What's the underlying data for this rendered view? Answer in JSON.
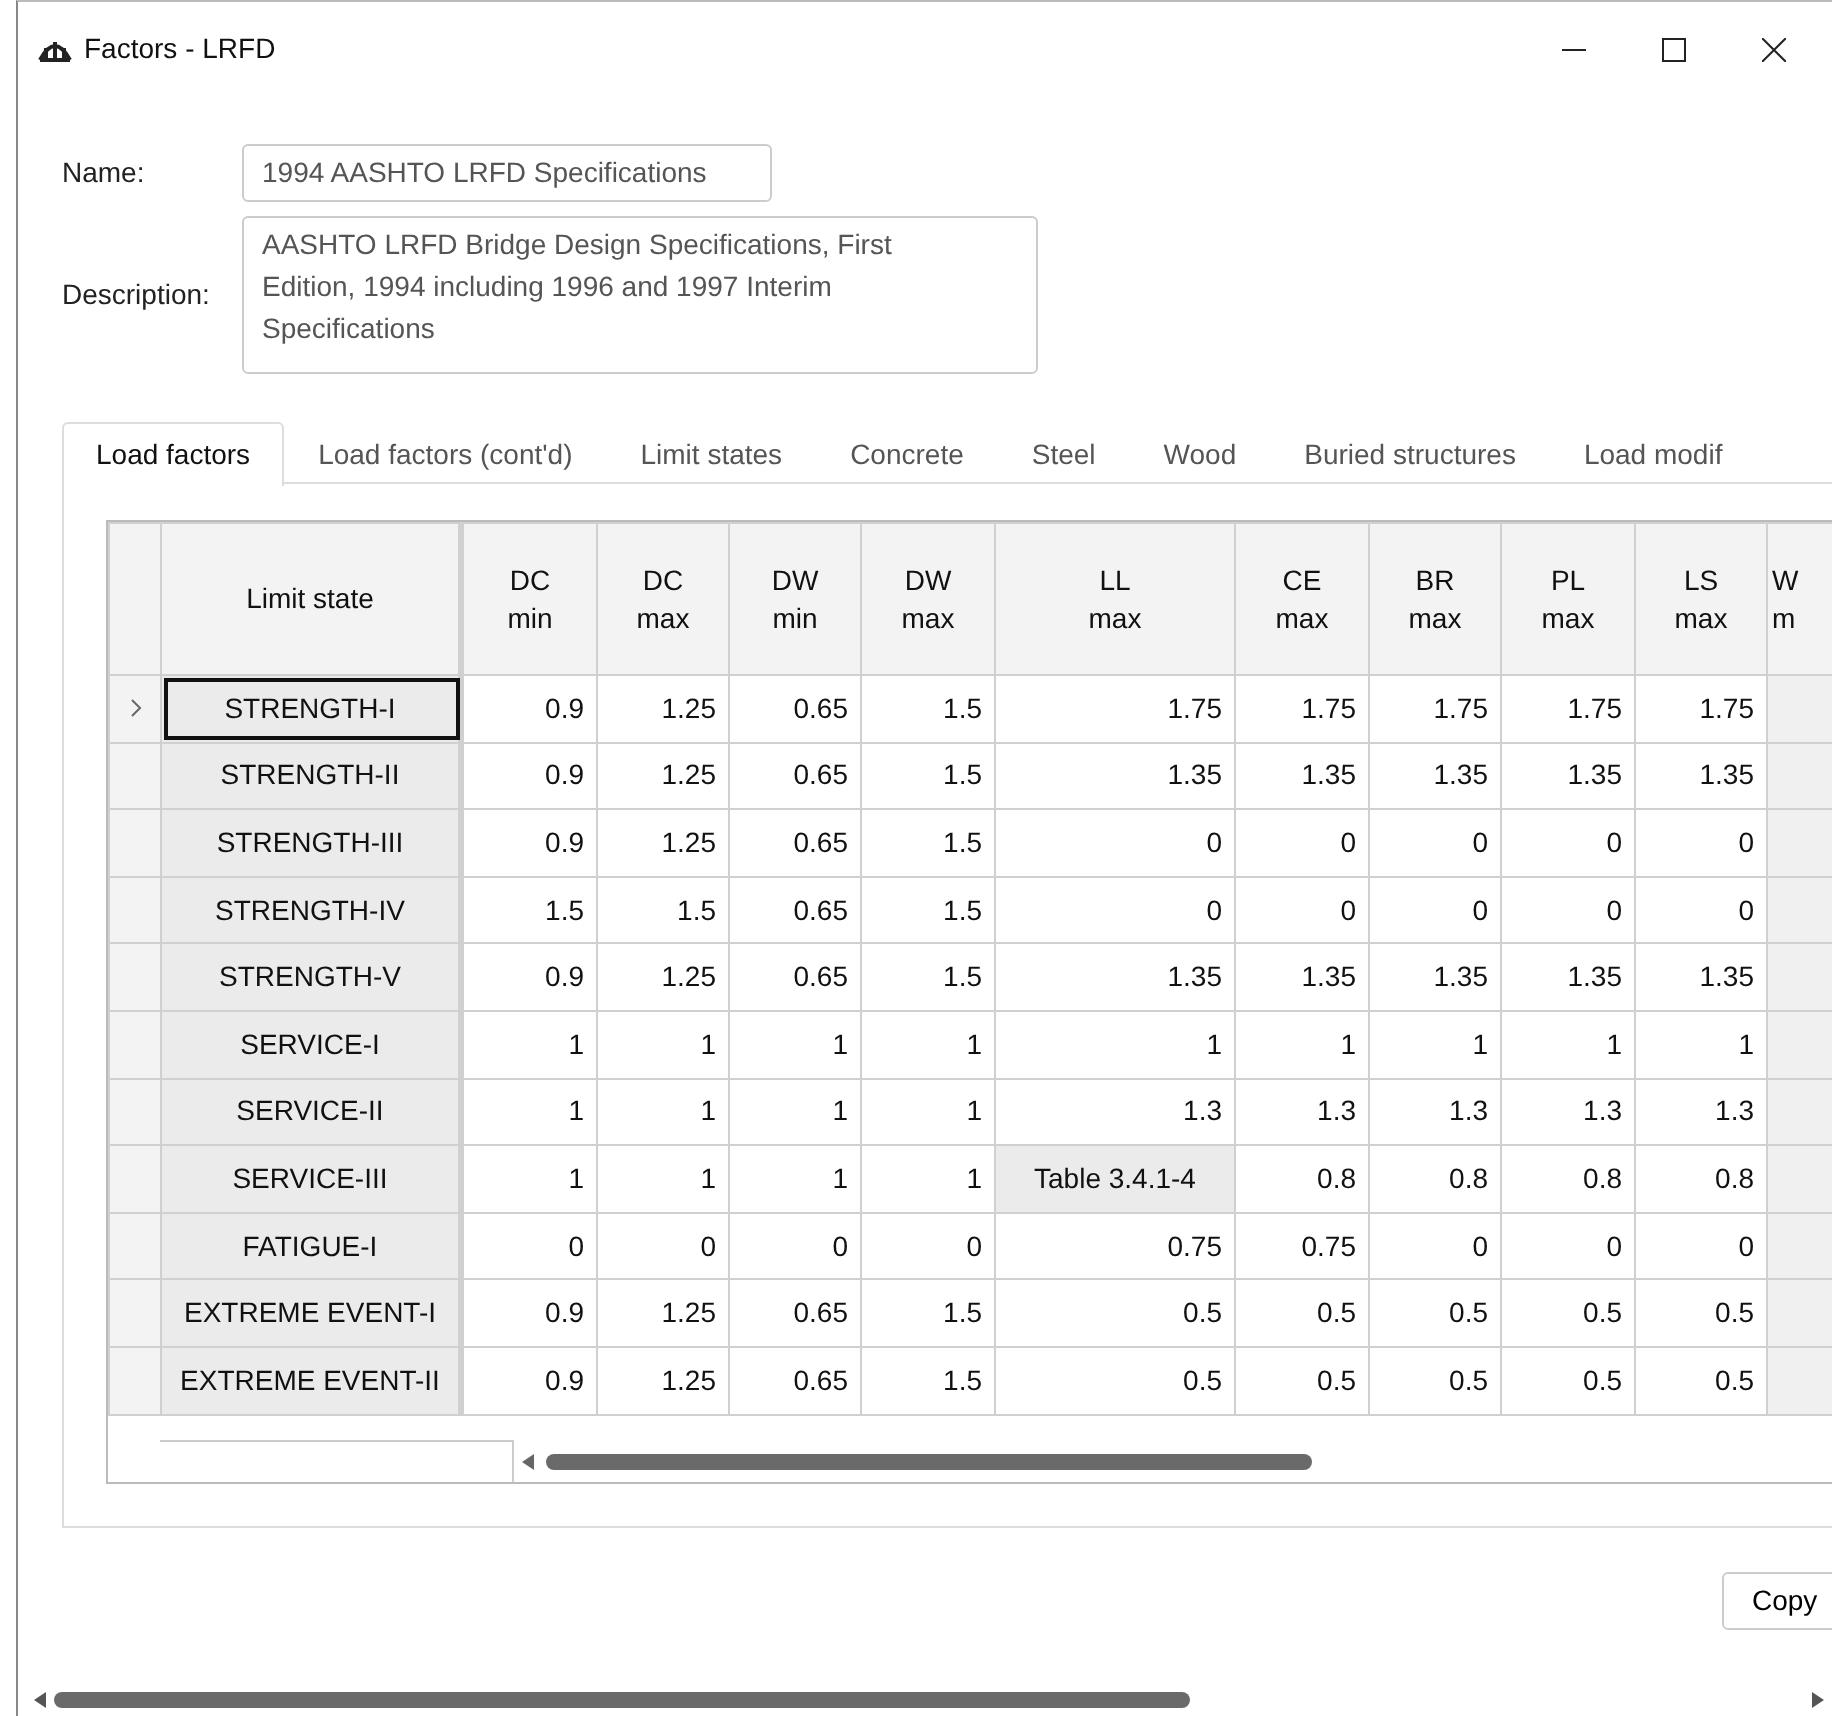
{
  "window": {
    "title": "Factors - LRFD"
  },
  "name": {
    "label": "Name:",
    "value": "1994 AASHTO LRFD Specifications"
  },
  "description": {
    "label": "Description:",
    "value": "AASHTO LRFD Bridge Design Specifications, First Edition, 1994 including 1996 and 1997 Interim Specifications"
  },
  "tabs": [
    {
      "label": "Load factors",
      "selected": true
    },
    {
      "label": "Load factors (cont'd)",
      "selected": false
    },
    {
      "label": "Limit states",
      "selected": false
    },
    {
      "label": "Concrete",
      "selected": false
    },
    {
      "label": "Steel",
      "selected": false
    },
    {
      "label": "Wood",
      "selected": false
    },
    {
      "label": "Buried structures",
      "selected": false
    },
    {
      "label": "Load modif",
      "selected": false
    }
  ],
  "table": {
    "columns": [
      [
        "Limit state"
      ],
      [
        "DC",
        "min"
      ],
      [
        "DC",
        "max"
      ],
      [
        "DW",
        "min"
      ],
      [
        "DW",
        "max"
      ],
      [
        "LL",
        "max"
      ],
      [
        "CE",
        "max"
      ],
      [
        "BR",
        "max"
      ],
      [
        "PL",
        "max"
      ],
      [
        "LS",
        "max"
      ],
      [
        "W",
        "m"
      ]
    ],
    "rows": [
      {
        "name": "STRENGTH-I",
        "selected": true,
        "values": [
          "0.9",
          "1.25",
          "0.65",
          "1.5",
          "1.75",
          "1.75",
          "1.75",
          "1.75",
          "1.75"
        ]
      },
      {
        "name": "STRENGTH-II",
        "selected": false,
        "values": [
          "0.9",
          "1.25",
          "0.65",
          "1.5",
          "1.35",
          "1.35",
          "1.35",
          "1.35",
          "1.35"
        ]
      },
      {
        "name": "STRENGTH-III",
        "selected": false,
        "values": [
          "0.9",
          "1.25",
          "0.65",
          "1.5",
          "0",
          "0",
          "0",
          "0",
          "0"
        ]
      },
      {
        "name": "STRENGTH-IV",
        "selected": false,
        "values": [
          "1.5",
          "1.5",
          "0.65",
          "1.5",
          "0",
          "0",
          "0",
          "0",
          "0"
        ]
      },
      {
        "name": "STRENGTH-V",
        "selected": false,
        "values": [
          "0.9",
          "1.25",
          "0.65",
          "1.5",
          "1.35",
          "1.35",
          "1.35",
          "1.35",
          "1.35"
        ]
      },
      {
        "name": "SERVICE-I",
        "selected": false,
        "values": [
          "1",
          "1",
          "1",
          "1",
          "1",
          "1",
          "1",
          "1",
          "1"
        ]
      },
      {
        "name": "SERVICE-II",
        "selected": false,
        "values": [
          "1",
          "1",
          "1",
          "1",
          "1.3",
          "1.3",
          "1.3",
          "1.3",
          "1.3"
        ]
      },
      {
        "name": "SERVICE-III",
        "selected": false,
        "values": [
          "1",
          "1",
          "1",
          "1",
          {
            "text": "Table 3.4.1-4",
            "kind": "reference"
          },
          "0.8",
          "0.8",
          "0.8",
          "0.8"
        ]
      },
      {
        "name": "FATIGUE-I",
        "selected": false,
        "values": [
          "0",
          "0",
          "0",
          "0",
          "0.75",
          "0.75",
          "0",
          "0",
          "0"
        ]
      },
      {
        "name": "EXTREME EVENT-I",
        "selected": false,
        "values": [
          "0.9",
          "1.25",
          "0.65",
          "1.5",
          "0.5",
          "0.5",
          "0.5",
          "0.5",
          "0.5"
        ]
      },
      {
        "name": "EXTREME EVENT-II",
        "selected": false,
        "values": [
          "0.9",
          "1.25",
          "0.65",
          "1.5",
          "0.5",
          "0.5",
          "0.5",
          "0.5",
          "0.5"
        ]
      }
    ]
  },
  "buttons": [
    "Copy"
  ]
}
